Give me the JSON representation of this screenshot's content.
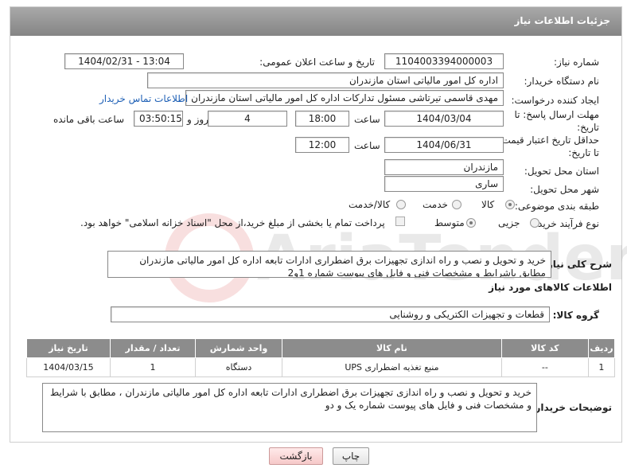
{
  "header": {
    "title": "جزئیات اطلاعات نیاز"
  },
  "fields": {
    "need_number_label": "شماره نیاز:",
    "need_number": "1104003394000003",
    "announce_label": "تاریخ و ساعت اعلان عمومی:",
    "announce_value": "1404/02/31 - 13:04",
    "buyer_org_label": "نام دستگاه خریدار:",
    "buyer_org": "اداره کل امور مالیاتی استان مازندران",
    "creator_label": "ایجاد کننده درخواست:",
    "creator": "مهدی قاسمی تیرتاشی مسئول تدارکات اداره کل امور مالیاتی استان مازندران",
    "contact_link": "اطلاعات تماس خریدار",
    "deadline_label_1": "مهلت ارسال پاسخ: تا",
    "deadline_label_2": "تاریخ:",
    "deadline_date": "1404/03/04",
    "time_label": "ساعت",
    "deadline_time": "18:00",
    "days_value": "4",
    "days_label": "روز و",
    "remaining_value": "03:50:15",
    "remaining_label": "ساعت باقی مانده",
    "price_label_1": "حداقل تاریخ اعتبار قیمت:",
    "price_label_2": "تا تاریخ:",
    "price_date": "1404/06/31",
    "price_time": "12:00",
    "province_label": "استان محل تحویل:",
    "province": "مازندران",
    "city_label": "شهر محل تحویل:",
    "city": "ساری",
    "category_label": "طبقه بندی موضوعی:",
    "category_goods": "کالا",
    "category_service": "خدمت",
    "category_both": "کالا/خدمت",
    "process_label": "نوع فرآیند خرید :",
    "process_partial": "جزیی",
    "process_medium": "متوسط",
    "payment_note": "پرداخت تمام یا بخشی از مبلغ خرید،از محل \"اسناد خزانه اسلامی\" خواهد بود.",
    "description_label": "شرح کلی نیاز:",
    "description": "خرید و تحویل و نصب و راه اندازی تجهیزات برق اضطراری ادارات تابعه اداره کل امور مالیاتی مازندران مطابق باشرایط و مشخصات فنی و فایل های پیوست شماره 1و2",
    "goods_info_title": "اطلاعات کالاهای مورد نیاز",
    "goods_group_label": "گروه کالا:",
    "goods_group": "قطعات و تجهیزات الکتریکی و روشنایی"
  },
  "table": {
    "headers": [
      "ردیف",
      "کد کالا",
      "نام کالا",
      "واحد شمارش",
      "تعداد / مقدار",
      "تاریخ نیاز"
    ],
    "rows": [
      [
        "1",
        "--",
        "منبع تغذیه اضطراری UPS",
        "دستگاه",
        "1",
        "1404/03/15"
      ]
    ]
  },
  "buyer_notes_label": "توضیحات خریدار:",
  "buyer_notes": "خرید و تحویل و نصب و راه اندازی تجهیزات برق اضطراری ادارات تابعه اداره کل امور مالیاتی مازندران ، مطابق با شرایط و مشخصات فنی و فایل های پیوست شماره یک و دو",
  "buttons": {
    "print": "چاپ",
    "back": "بازگشت"
  },
  "watermark_text": "AriaTender.neT",
  "colors": {
    "header": "#8f8f8f",
    "link": "#1d5fb5",
    "back_button": "#f6c9c9"
  }
}
